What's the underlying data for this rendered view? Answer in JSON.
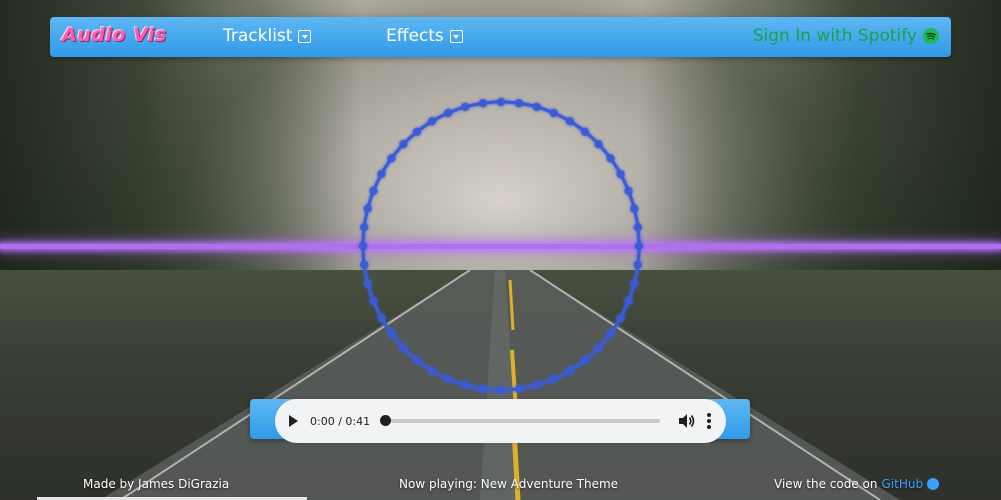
{
  "navbar": {
    "brand": "Audio Vis",
    "tracklist_label": "Tracklist",
    "effects_label": "Effects",
    "spotify_label": "Sign In with Spotify"
  },
  "player": {
    "current_time": "0:00",
    "separator": " / ",
    "duration": "0:41",
    "progress_fraction": 0.0
  },
  "footer": {
    "credit": "Made by James DiGrazia",
    "now_playing": "Now playing: New Adventure Theme",
    "code_prefix": "View the code on ",
    "github_label": "GitHub"
  },
  "colors": {
    "navbar_blue": "#2f9ae8",
    "brand_pink": "#ff5fb0",
    "spotify_green": "#1db954",
    "visualizer_ring": "#3b5bd6",
    "visualizer_line": "#b06ef0",
    "github_link": "#3aa0ff"
  },
  "icons": {
    "tracklist_dropdown": "chevron-down-box-icon",
    "effects_dropdown": "chevron-down-box-icon",
    "spotify": "spotify-icon",
    "play": "play-icon",
    "volume": "volume-icon",
    "more": "more-vertical-icon",
    "github": "github-icon"
  }
}
